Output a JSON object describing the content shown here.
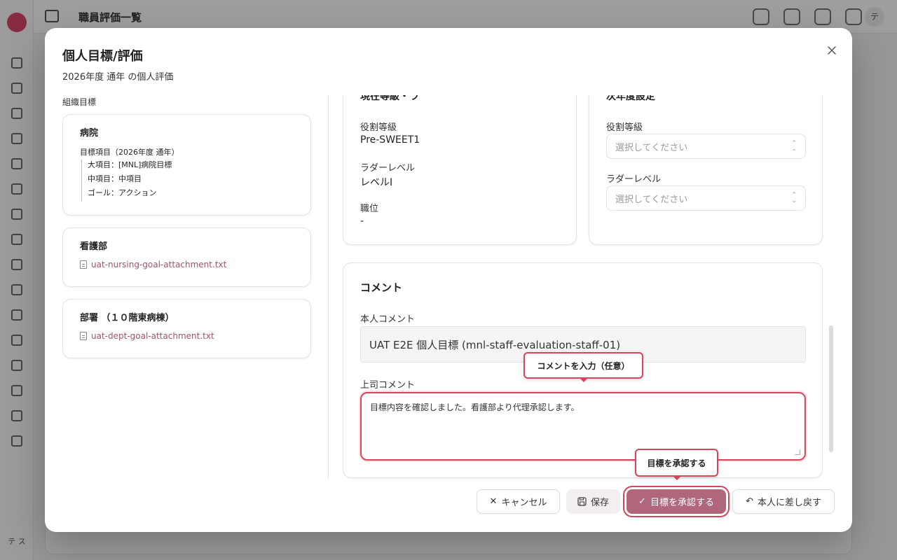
{
  "background": {
    "page_title": "職員評価一覧",
    "user_initial": "テ",
    "rail_user": "テ ス"
  },
  "dialog": {
    "title": "個人目標/評価",
    "subtitle": "2026年度 通年 の個人評価"
  },
  "org_goals": {
    "label": "組織目標",
    "hospital": {
      "title": "病院",
      "goal_head": "目標項目（2026年度 通年）",
      "lines": [
        "大項目：[MNL]病院目標",
        "中項目：中項目",
        "ゴール：アクション"
      ]
    },
    "nursing": {
      "title": "看護部",
      "file": "uat-nursing-goal-attachment.txt"
    },
    "dept": {
      "title": "部署 （１０階東病棟）",
      "file": "uat-dept-goal-attachment.txt"
    }
  },
  "current_grade": {
    "heading_clipped": "現在等級・ラ",
    "role_label": "役割等級",
    "role_value": "Pre-SWEET1",
    "ladder_label": "ラダーレベル",
    "ladder_value": "レベルI",
    "position_label": "職位",
    "position_value": "-"
  },
  "next_year": {
    "heading_clipped": "次年度設定",
    "role_label": "役割等級",
    "role_placeholder": "選択してください",
    "ladder_label": "ラダーレベル",
    "ladder_placeholder": "選択してください"
  },
  "comments": {
    "title": "コメント",
    "self_label": "本人コメント",
    "self_value": "UAT E2E 個人目標 (mnl-staff-evaluation-staff-01)",
    "boss_label": "上司コメント",
    "boss_value": "目標内容を確認しました。看護部より代理承認します。"
  },
  "tooltips": {
    "comment_hint": "コメントを入力（任意）",
    "approve_hint": "目標を承認する"
  },
  "footer": {
    "cancel": "キャンセル",
    "save": "保存",
    "approve": "目標を承認する",
    "return": "本人に差し戻す"
  },
  "colors": {
    "accent": "#b0677c",
    "highlight": "#d6455c",
    "link": "#a0546a"
  }
}
